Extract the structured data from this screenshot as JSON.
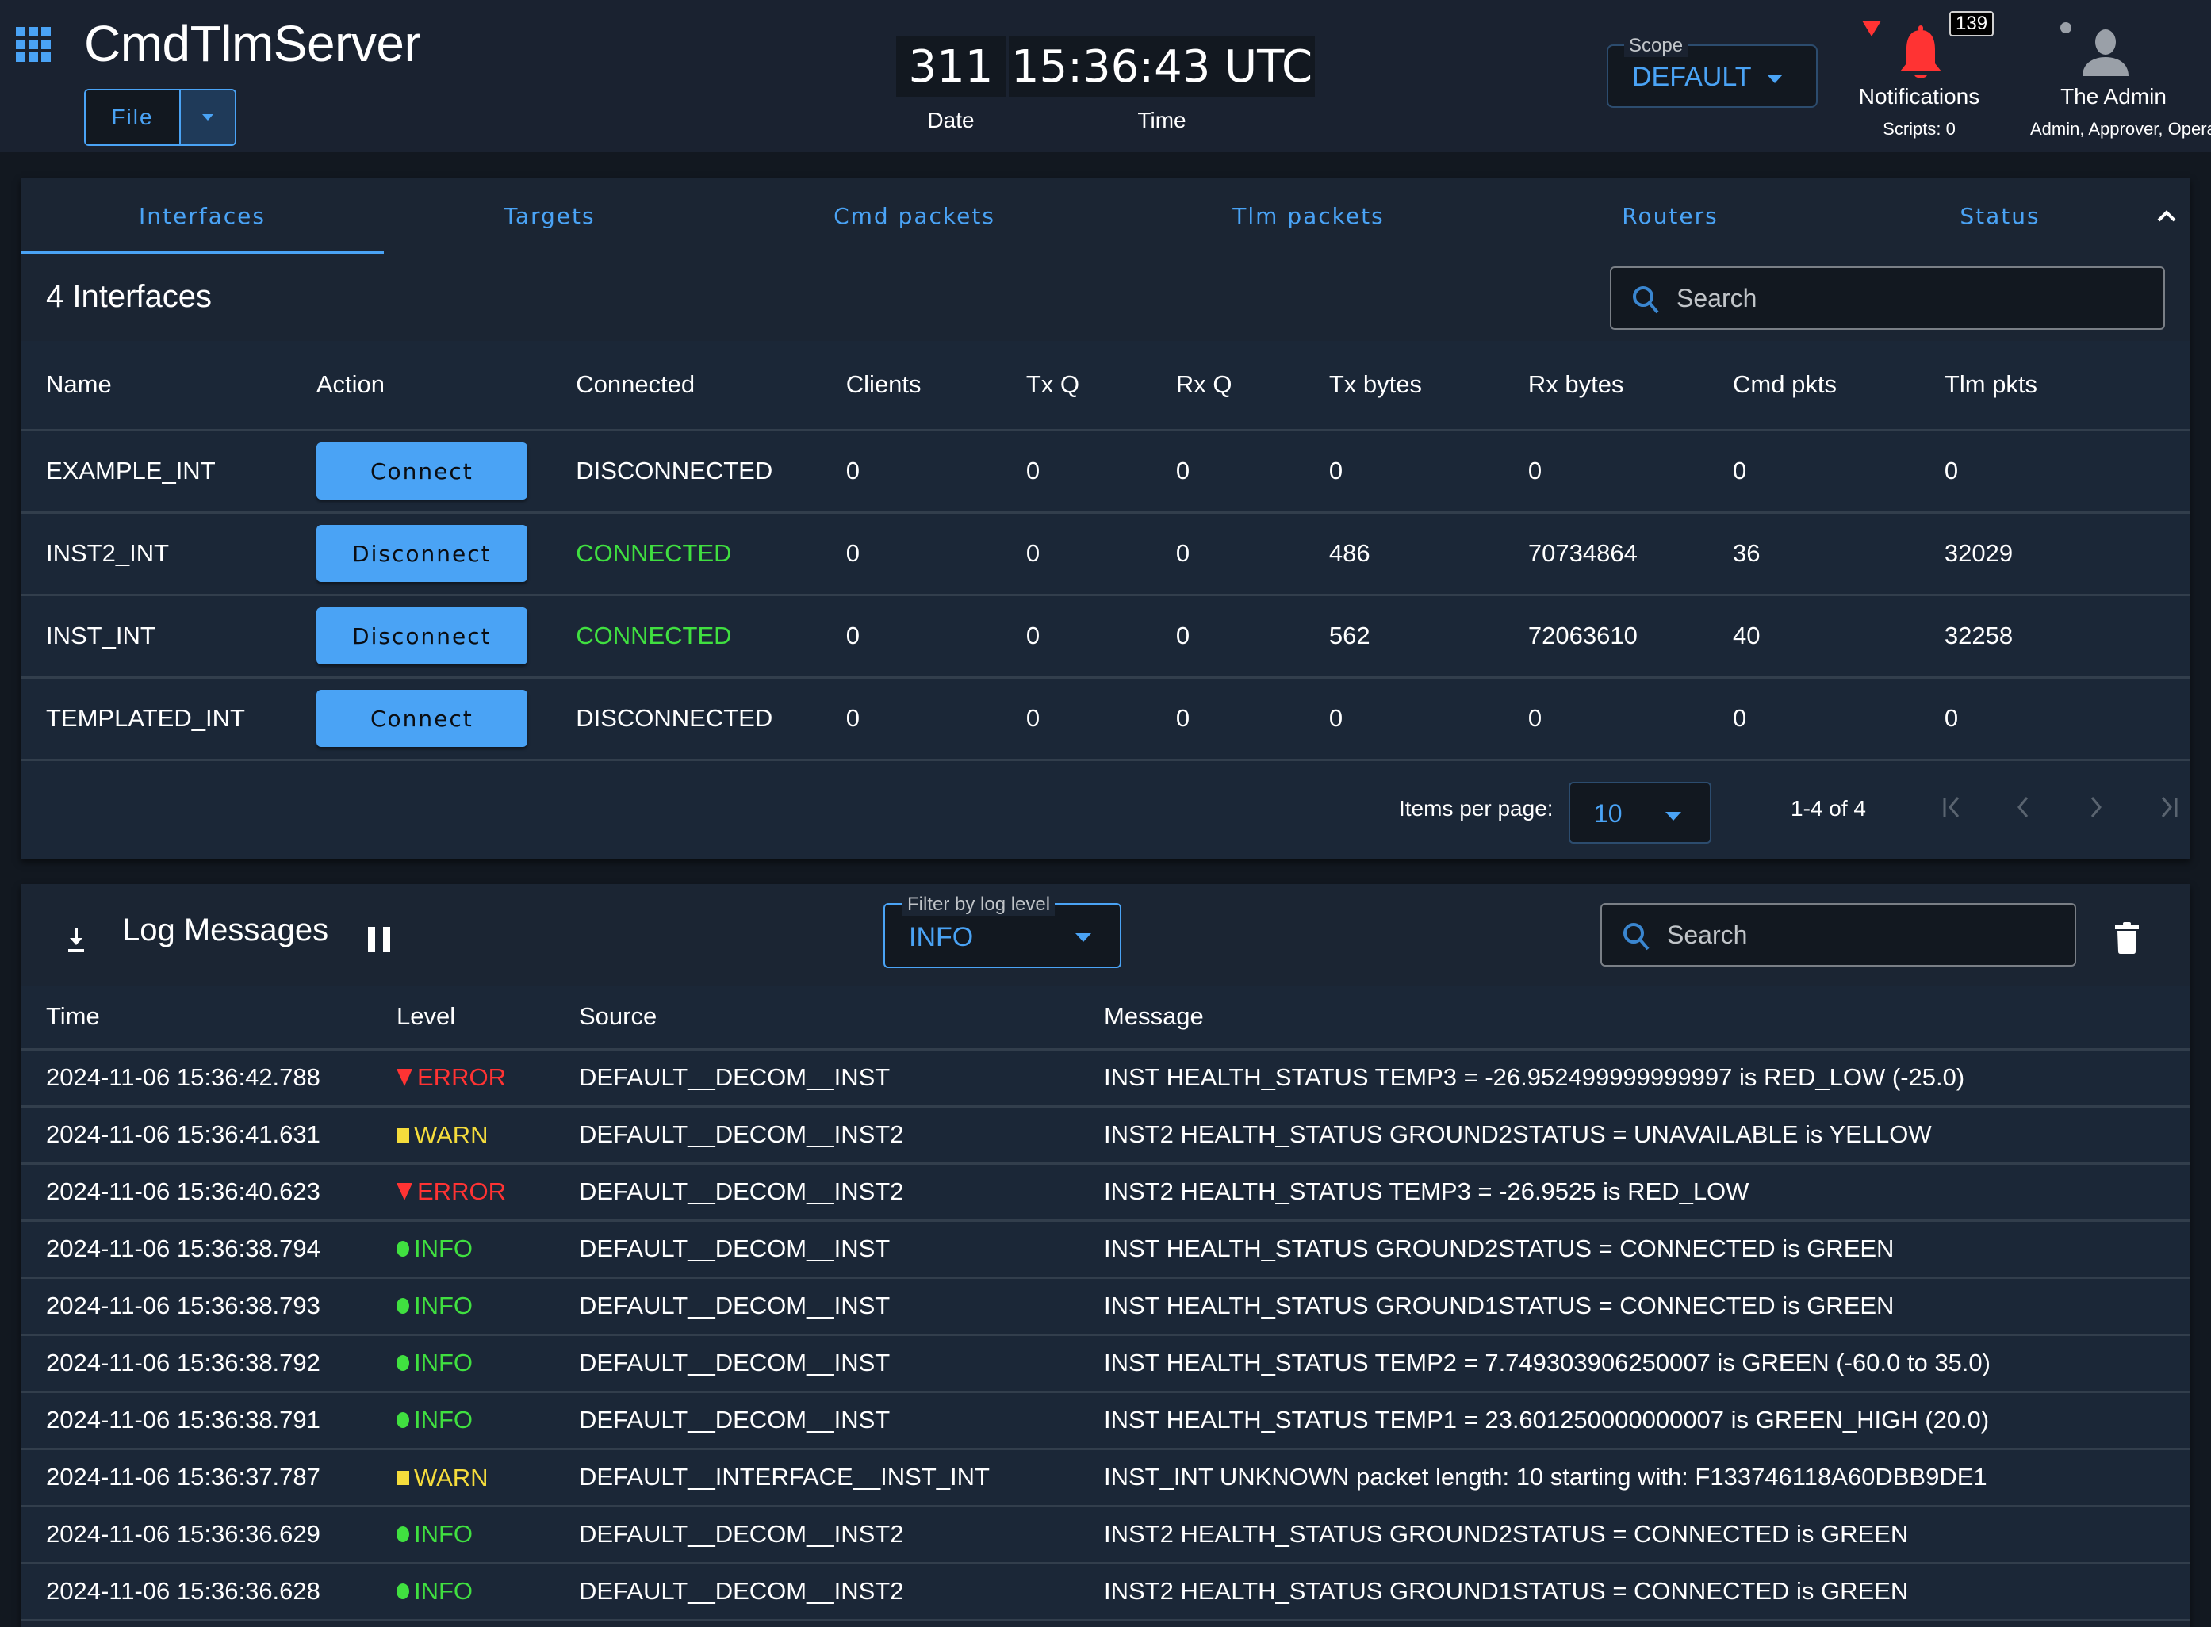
{
  "header": {
    "app_title": "CmdTlmServer",
    "file_menu_label": "File",
    "clock": {
      "date_value": "311",
      "time_value": "15:36:43 UTC",
      "date_label": "Date",
      "time_label": "Time"
    },
    "scope": {
      "label": "Scope",
      "value": "DEFAULT"
    },
    "notifications": {
      "label": "Notifications",
      "count": "139",
      "scripts": "Scripts: 0",
      "alert_color": "#ff3333"
    },
    "user": {
      "name": "The Admin",
      "roles": "Admin, Approver, Operator"
    }
  },
  "colors": {
    "accent": "#4aa3f5",
    "connected": "#40e040",
    "error": "#ff3333",
    "warn": "#f5dc3c",
    "info": "#40e040"
  },
  "tabs": [
    {
      "label": "Interfaces",
      "active": true
    },
    {
      "label": "Targets",
      "active": false
    },
    {
      "label": "Cmd packets",
      "active": false
    },
    {
      "label": "Tlm packets",
      "active": false
    },
    {
      "label": "Routers",
      "active": false
    },
    {
      "label": "Status",
      "active": false
    }
  ],
  "interfaces": {
    "title": "4 Interfaces",
    "search_placeholder": "Search",
    "columns": [
      "Name",
      "Action",
      "Connected",
      "Clients",
      "Tx Q",
      "Rx Q",
      "Tx bytes",
      "Rx bytes",
      "Cmd pkts",
      "Tlm pkts"
    ],
    "rows": [
      {
        "name": "EXAMPLE_INT",
        "action": "Connect",
        "connected": "DISCONNECTED",
        "clients": "0",
        "txq": "0",
        "rxq": "0",
        "txbytes": "0",
        "rxbytes": "0",
        "cmdpkts": "0",
        "tlmpkts": "0"
      },
      {
        "name": "INST2_INT",
        "action": "Disconnect",
        "connected": "CONNECTED",
        "clients": "0",
        "txq": "0",
        "rxq": "0",
        "txbytes": "486",
        "rxbytes": "70734864",
        "cmdpkts": "36",
        "tlmpkts": "32029"
      },
      {
        "name": "INST_INT",
        "action": "Disconnect",
        "connected": "CONNECTED",
        "clients": "0",
        "txq": "0",
        "rxq": "0",
        "txbytes": "562",
        "rxbytes": "72063610",
        "cmdpkts": "40",
        "tlmpkts": "32258"
      },
      {
        "name": "TEMPLATED_INT",
        "action": "Connect",
        "connected": "DISCONNECTED",
        "clients": "0",
        "txq": "0",
        "rxq": "0",
        "txbytes": "0",
        "rxbytes": "0",
        "cmdpkts": "0",
        "tlmpkts": "0"
      }
    ],
    "pagination": {
      "items_per_page_label": "Items per page:",
      "items_per_page": "10",
      "range": "1-4 of 4"
    }
  },
  "log": {
    "title": "Log Messages",
    "filter_label": "Filter by log level",
    "filter_value": "INFO",
    "search_placeholder": "Search",
    "columns": [
      "Time",
      "Level",
      "Source",
      "Message"
    ],
    "rows": [
      {
        "time": "2024-11-06 15:36:42.788",
        "level": "ERROR",
        "source": "DEFAULT__DECOM__INST",
        "message": "INST HEALTH_STATUS TEMP3 = -26.952499999999997 is RED_LOW (-25.0)"
      },
      {
        "time": "2024-11-06 15:36:41.631",
        "level": "WARN",
        "source": "DEFAULT__DECOM__INST2",
        "message": "INST2 HEALTH_STATUS GROUND2STATUS = UNAVAILABLE is YELLOW"
      },
      {
        "time": "2024-11-06 15:36:40.623",
        "level": "ERROR",
        "source": "DEFAULT__DECOM__INST2",
        "message": "INST2 HEALTH_STATUS TEMP3 = -26.9525 is RED_LOW"
      },
      {
        "time": "2024-11-06 15:36:38.794",
        "level": "INFO",
        "source": "DEFAULT__DECOM__INST",
        "message": "INST HEALTH_STATUS GROUND2STATUS = CONNECTED is GREEN"
      },
      {
        "time": "2024-11-06 15:36:38.793",
        "level": "INFO",
        "source": "DEFAULT__DECOM__INST",
        "message": "INST HEALTH_STATUS GROUND1STATUS = CONNECTED is GREEN"
      },
      {
        "time": "2024-11-06 15:36:38.792",
        "level": "INFO",
        "source": "DEFAULT__DECOM__INST",
        "message": "INST HEALTH_STATUS TEMP2 = 7.749303906250007 is GREEN (-60.0 to 35.0)"
      },
      {
        "time": "2024-11-06 15:36:38.791",
        "level": "INFO",
        "source": "DEFAULT__DECOM__INST",
        "message": "INST HEALTH_STATUS TEMP1 = 23.601250000000007 is GREEN_HIGH (20.0)"
      },
      {
        "time": "2024-11-06 15:36:37.787",
        "level": "WARN",
        "source": "DEFAULT__INTERFACE__INST_INT",
        "message": "INST_INT UNKNOWN packet length: 10 starting with: F133746118A60DBB9DE1"
      },
      {
        "time": "2024-11-06 15:36:36.629",
        "level": "INFO",
        "source": "DEFAULT__DECOM__INST2",
        "message": "INST2 HEALTH_STATUS GROUND2STATUS = CONNECTED is GREEN"
      },
      {
        "time": "2024-11-06 15:36:36.628",
        "level": "INFO",
        "source": "DEFAULT__DECOM__INST2",
        "message": "INST2 HEALTH_STATUS GROUND1STATUS = CONNECTED is GREEN"
      }
    ]
  }
}
